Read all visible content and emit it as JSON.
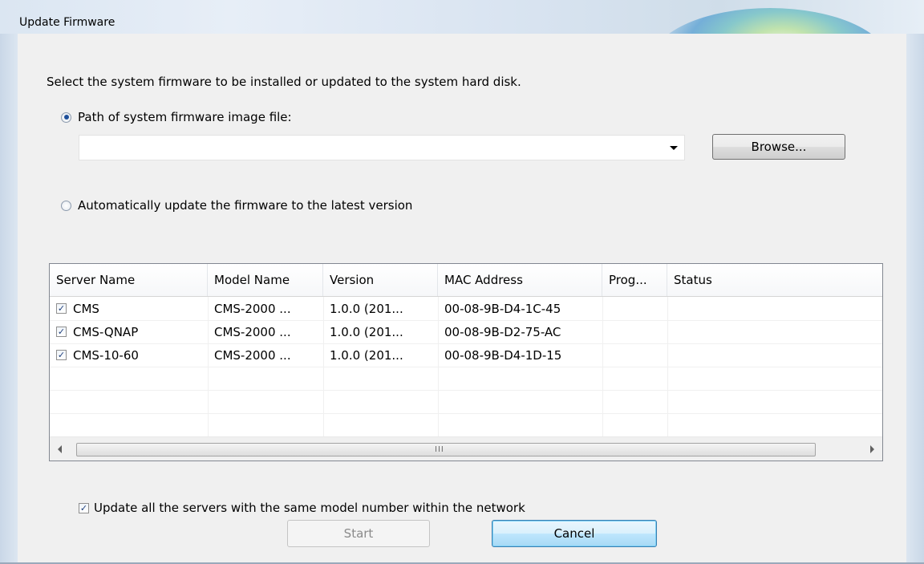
{
  "window": {
    "title": "Update Firmware"
  },
  "instruction": "Select the system firmware to be installed or updated to the system hard disk.",
  "options": {
    "path_label": "Path of system firmware image file:",
    "path_selected": true,
    "path_value": "",
    "browse_label": "Browse...",
    "auto_label": "Automatically update the firmware to the latest version",
    "auto_selected": false
  },
  "table": {
    "columns": [
      "Server Name",
      "Model Name",
      "Version",
      "MAC Address",
      "Prog...",
      "Status"
    ],
    "rows": [
      {
        "checked": true,
        "server": "CMS",
        "model": "CMS-2000 ...",
        "version": "1.0.0 (201...",
        "mac": "00-08-9B-D4-1C-45",
        "progress": "",
        "status": ""
      },
      {
        "checked": true,
        "server": "CMS-QNAP",
        "model": "CMS-2000 ...",
        "version": "1.0.0 (201...",
        "mac": "00-08-9B-D2-75-AC",
        "progress": "",
        "status": ""
      },
      {
        "checked": true,
        "server": "CMS-10-60",
        "model": "CMS-2000 ...",
        "version": "1.0.0 (201...",
        "mac": "00-08-9B-D4-1D-15",
        "progress": "",
        "status": ""
      }
    ],
    "scrollbar_grip": "III"
  },
  "update_all": {
    "label": "Update all the servers with the same model number within the network",
    "checked": true
  },
  "buttons": {
    "start": "Start",
    "cancel": "Cancel"
  },
  "icons": {
    "check": "check-icon",
    "radio": "radio-icon",
    "dropdown": "chevron-down-icon",
    "left": "arrow-left-icon",
    "right": "arrow-right-icon"
  }
}
